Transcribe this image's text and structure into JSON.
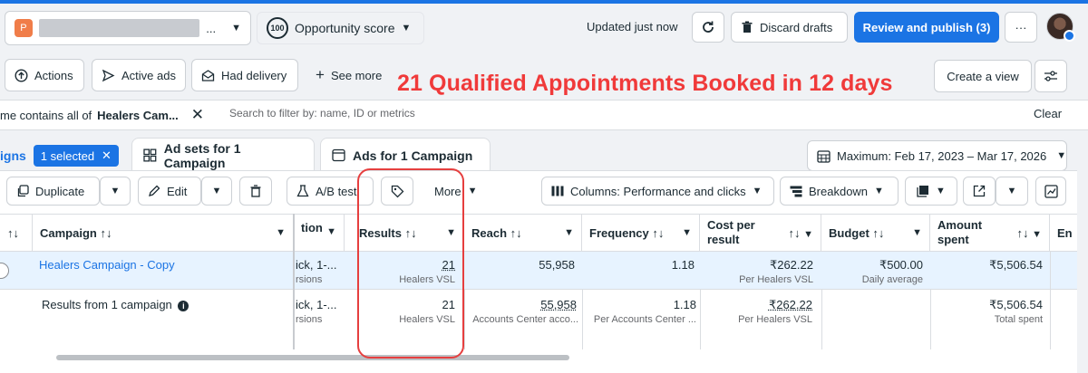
{
  "header": {
    "account_initial": "P",
    "account_name_suffix": "...",
    "opportunity_badge": "100",
    "opportunity_label": "Opportunity score",
    "updated": "Updated just now",
    "discard_label": "Discard drafts",
    "review_publish_label": "Review and publish (3)",
    "more_label": "···"
  },
  "filters": {
    "actions_label": "Actions",
    "active_ads_label": "Active ads",
    "had_delivery_label": "Had delivery",
    "see_more_label": "See more",
    "create_view_label": "Create a view",
    "chip_prefix": "me contains all of",
    "chip_value": "Healers Cam...",
    "search_placeholder": "Search to filter by: name, ID or metrics",
    "clear_label": "Clear"
  },
  "headline": "21 Qualified Appointments Booked in 12 days",
  "tabs": {
    "campaigns_partial": "igns",
    "selected_badge": "1 selected",
    "ad_sets": "Ad sets for 1 Campaign",
    "ads": "Ads for 1 Campaign",
    "date_range": "Maximum: Feb 17, 2023 – Mar 17, 2026"
  },
  "toolbar": {
    "duplicate": "Duplicate",
    "edit": "Edit",
    "ab_test": "A/B test",
    "more": "More",
    "columns": "Columns: Performance and clicks",
    "breakdown": "Breakdown"
  },
  "table": {
    "headers": {
      "sort_partial": "↑↓",
      "campaign": "Campaign ↑↓",
      "attribution_partial": "tion",
      "results": "Results ↑↓",
      "reach": "Reach ↑↓",
      "frequency": "Frequency ↑↓",
      "cost_per_result_1": "Cost per",
      "cost_per_result_2": "result",
      "cost_sort": "↑↓",
      "budget": "Budget ↑↓",
      "amount_spent_1": "Amount",
      "amount_spent_2": "spent",
      "amount_sort": "↑↓",
      "ends_partial": "En"
    },
    "row1": {
      "campaign": "Healers Campaign - Copy",
      "attribution_1": "ick, 1-...",
      "attribution_2": "rsions",
      "results": "21",
      "results_sub": "Healers VSL",
      "reach": "55,958",
      "frequency": "1.18",
      "cost_per_result": "₹262.22",
      "cost_sub": "Per Healers VSL",
      "budget": "₹500.00",
      "budget_sub": "Daily average",
      "amount_spent": "₹5,506.54"
    },
    "row2": {
      "campaign": "Results from 1 campaign",
      "attribution_1": "ick, 1-...",
      "attribution_2": "rsions",
      "results": "21",
      "results_sub": "Healers VSL",
      "reach": "55,958",
      "reach_sub": "Accounts Center acco...",
      "frequency": "1.18",
      "frequency_sub": "Per Accounts Center ...",
      "cost_per_result": "₹262.22",
      "cost_sub": "Per Healers VSL",
      "amount_spent": "₹5,506.54",
      "amount_sub": "Total spent"
    }
  },
  "colors": {
    "accent": "#1b74e4",
    "headline": "#f03a3a",
    "account_badge": "#f07d49"
  }
}
